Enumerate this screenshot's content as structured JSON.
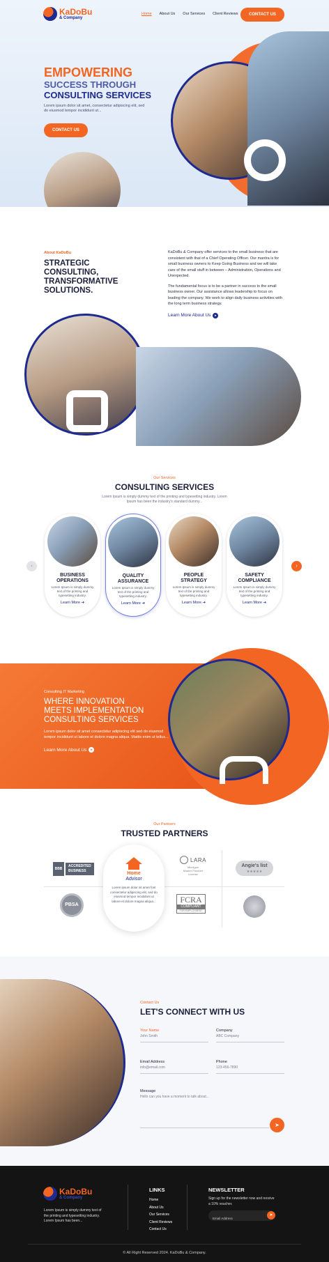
{
  "brand": {
    "name": "KaDoBu",
    "sub": "& Company"
  },
  "nav": {
    "items": [
      {
        "label": "Home"
      },
      {
        "label": "About Us"
      },
      {
        "label": "Our Services"
      },
      {
        "label": "Client Reviews"
      }
    ],
    "cta": "CONTACT US"
  },
  "hero": {
    "line1": "EMPOWERING",
    "line2": "SUCCESS THROUGH",
    "line3": "CONSULTING SERVICES",
    "desc1": "Lorem ipsum dolor sit amet, consectetur adipiscing elit, sed",
    "desc2": "do eiusmod tempor incididunt ut...",
    "cta": "CONTACT US"
  },
  "about": {
    "eyebrow": "About KaDoBu",
    "heading1": "STRATEGIC",
    "heading2": "CONSULTING,",
    "heading3": "TRANSFORMATIVE",
    "heading4": "SOLUTIONS.",
    "p1": "KaDoBu & Company offer services to the small business that are consistent with that of a Chief Operating Officer. Our mantra is for small business owners to Keep Going Business and we will take care of the small stuff in between – Administration, Operations and Unexpected.",
    "p2": "The fundamental focus is to be a partner in success to the small business owner. Our assistance allows leadership to focus on leading the company. We work to align daily business activities with the long term business strategy.",
    "link": "Learn More About Us"
  },
  "services": {
    "eyebrow": "Our Services",
    "heading": "CONSULTING SERVICES",
    "desc1": "Lorem Ipsum is simply dummy text of the printing and typesetting industry. Lorem",
    "desc2": "Ipsum has been the industry's standard dummy...",
    "cards": [
      {
        "title1": "BUSINESS",
        "title2": "OPERATIONS",
        "text": "Lorem Ipsum is simply dummy text of the printing and typesetting industry.",
        "link": "Learn More"
      },
      {
        "title1": "QUALITY",
        "title2": "ASSURANCE",
        "text": "Lorem Ipsum is simply dummy text of the printing and typesetting industry.",
        "link": "Learn More"
      },
      {
        "title1": "PEOPLE",
        "title2": "STRATEGY",
        "text": "Lorem Ipsum is simply dummy text of the printing and typesetting industry.",
        "link": "Learn More"
      },
      {
        "title1": "SAFETY",
        "title2": "COMPLIANCE",
        "text": "Lorem Ipsum is simply dummy text of the printing and typesetting industry.",
        "link": "Learn More"
      }
    ]
  },
  "it": {
    "eyebrow": "Consulting IT Marketing",
    "h1": "WHERE INNOVATION",
    "h2": "MEETS IMPLEMENTATION",
    "h3": "CONSULTING SERVICES",
    "desc": "Lorem ipsum dolor sit amet consectetur adipiscing elit sed do eiusmod tempor incididunt ut labore et dolore magna aliqua. Mattis enim ut tellus...",
    "link": "Learn More About Us"
  },
  "partners": {
    "eyebrow": "Our Partners",
    "heading": "TRUSTED PARTNERS",
    "bbb": {
      "l1": "ACCREDITED",
      "l2": "BUSINESS",
      "tag": "BBB"
    },
    "home": {
      "l1": "Home",
      "l2": "Advisor",
      "text": "Lorem ipsum dolor sit amet font consectetur adipiscing elit, sed do eiusmod tempor incididunt ut labore et dolore magna aliqua..."
    },
    "lara": {
      "name": "LARA",
      "sub1": "Michigan",
      "sub2": "Master Plumber",
      "sub3": "License"
    },
    "angies": {
      "name": "Angie's list",
      "stars": "★★★★★"
    },
    "pbsa": {
      "name": "PBSA"
    },
    "fcra": {
      "name": "FCRA",
      "l2": "COMPLIANT",
      "l3": "FOR EMPLOYMENT"
    }
  },
  "contact": {
    "eyebrow": "Contact Us",
    "heading": "LET'S CONNECT WITH US",
    "fields": {
      "name_label": "Your Name",
      "name_ph": "John Smith",
      "company_label": "Company",
      "company_ph": "ABC Company",
      "email_label": "Email Address",
      "email_ph": "info@email.com",
      "phone_label": "Phone",
      "phone_ph": "123-456-7890",
      "message_label": "Message",
      "message_ph": "Hello can you have a moment to talk about..."
    }
  },
  "footer": {
    "desc1": "Lorem Ipsum is simply dummy text of",
    "desc2": "the printing and typesetting industry.",
    "desc3": "Lorem Ipsum has been...",
    "links_title": "LINKS",
    "links": [
      "Home",
      "About Us",
      "Our Services",
      "Client Reviews",
      "Contact Us"
    ],
    "news_title": "NEWSLETTER",
    "news_desc1": "Sign up for the newsletter now and receive",
    "news_desc2": "a 10% voucher.",
    "email_ph": "Email Address",
    "copyright": "© All Right Reserved 2024. KaDoBu & Company."
  },
  "colors": {
    "accent": "#f26522",
    "brand": "#1d2a8f",
    "footer_bg": "#141414"
  }
}
